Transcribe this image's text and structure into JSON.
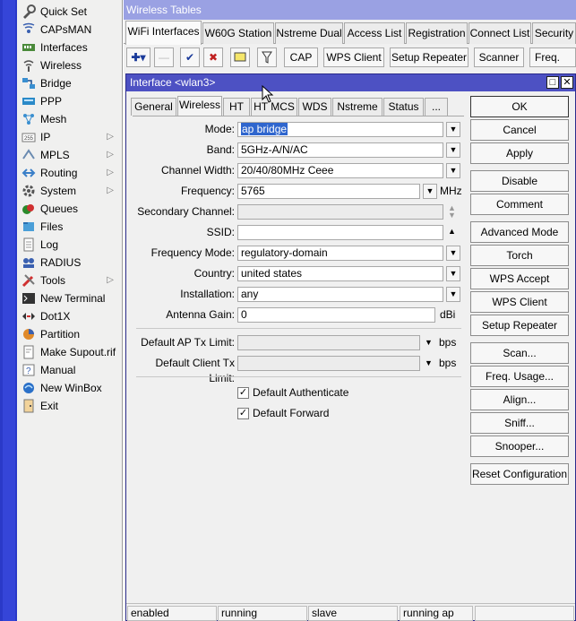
{
  "menu": {
    "items": [
      {
        "label": "Quick Set",
        "icon": "quick-set-icon",
        "arrow": ""
      },
      {
        "label": "CAPsMAN",
        "icon": "capsman-icon",
        "arrow": ""
      },
      {
        "label": "Interfaces",
        "icon": "interfaces-icon",
        "arrow": ""
      },
      {
        "label": "Wireless",
        "icon": "wireless-icon",
        "arrow": ""
      },
      {
        "label": "Bridge",
        "icon": "bridge-icon",
        "arrow": ""
      },
      {
        "label": "PPP",
        "icon": "ppp-icon",
        "arrow": ""
      },
      {
        "label": "Mesh",
        "icon": "mesh-icon",
        "arrow": ""
      },
      {
        "label": "IP",
        "icon": "ip-icon",
        "arrow": "▷"
      },
      {
        "label": "MPLS",
        "icon": "mpls-icon",
        "arrow": "▷"
      },
      {
        "label": "Routing",
        "icon": "routing-icon",
        "arrow": "▷"
      },
      {
        "label": "System",
        "icon": "system-icon",
        "arrow": "▷"
      },
      {
        "label": "Queues",
        "icon": "queues-icon",
        "arrow": ""
      },
      {
        "label": "Files",
        "icon": "files-icon",
        "arrow": ""
      },
      {
        "label": "Log",
        "icon": "log-icon",
        "arrow": ""
      },
      {
        "label": "RADIUS",
        "icon": "radius-icon",
        "arrow": ""
      },
      {
        "label": "Tools",
        "icon": "tools-icon",
        "arrow": "▷"
      },
      {
        "label": "New Terminal",
        "icon": "terminal-icon",
        "arrow": ""
      },
      {
        "label": "Dot1X",
        "icon": "dot1x-icon",
        "arrow": ""
      },
      {
        "label": "Partition",
        "icon": "partition-icon",
        "arrow": ""
      },
      {
        "label": "Make Supout.rif",
        "icon": "supout-icon",
        "arrow": ""
      },
      {
        "label": "Manual",
        "icon": "manual-icon",
        "arrow": ""
      },
      {
        "label": "New WinBox",
        "icon": "winbox-icon",
        "arrow": ""
      },
      {
        "label": "Exit",
        "icon": "exit-icon",
        "arrow": ""
      }
    ]
  },
  "window": {
    "title": "Wireless Tables",
    "tabs": [
      "WiFi Interfaces",
      "W60G Station",
      "Nstreme Dual",
      "Access List",
      "Registration",
      "Connect List",
      "Security"
    ],
    "active_tab": 0
  },
  "toolbar": {
    "add": "✚▾",
    "remove": "—",
    "enable": "✔",
    "disable": "✖",
    "comment": "",
    "filter": "",
    "buttons": [
      "CAP",
      "WPS Client",
      "Setup Repeater",
      "Scanner",
      "Freq. Usa"
    ]
  },
  "dialog": {
    "title": "Interface <wlan3>",
    "tabs": [
      "General",
      "Wireless",
      "HT",
      "HT MCS",
      "WDS",
      "Nstreme",
      "Status",
      "..."
    ],
    "active_tab": 1,
    "fields": {
      "mode": {
        "label": "Mode:",
        "value": "ap bridge"
      },
      "band": {
        "label": "Band:",
        "value": "5GHz-A/N/AC"
      },
      "channel_width": {
        "label": "Channel Width:",
        "value": "20/40/80MHz Ceee"
      },
      "frequency": {
        "label": "Frequency:",
        "value": "5765",
        "unit": "MHz"
      },
      "secondary_channel": {
        "label": "Secondary Channel:",
        "value": ""
      },
      "ssid": {
        "label": "SSID:",
        "value": ""
      },
      "frequency_mode": {
        "label": "Frequency Mode:",
        "value": "regulatory-domain"
      },
      "country": {
        "label": "Country:",
        "value": "united states"
      },
      "installation": {
        "label": "Installation:",
        "value": "any"
      },
      "antenna_gain": {
        "label": "Antenna Gain:",
        "value": "0",
        "unit": "dBi"
      },
      "default_ap_tx_limit": {
        "label": "Default AP Tx Limit:",
        "value": "",
        "unit": "bps"
      },
      "default_client_tx_limit": {
        "label": "Default Client Tx Limit:",
        "value": "",
        "unit": "bps"
      }
    },
    "checkboxes": {
      "default_authenticate": {
        "label": "Default Authenticate",
        "checked": true
      },
      "default_forward": {
        "label": "Default Forward",
        "checked": true
      }
    },
    "buttons": [
      "OK",
      "Cancel",
      "Apply",
      "Disable",
      "Comment",
      "Advanced Mode",
      "Torch",
      "WPS Accept",
      "WPS Client",
      "Setup Repeater",
      "Scan...",
      "Freq. Usage...",
      "Align...",
      "Sniff...",
      "Snooper...",
      "Reset Configuration"
    ],
    "status": [
      "enabled",
      "running",
      "slave",
      "running ap",
      ""
    ]
  },
  "colors": {
    "sidebar_strip": "#2a39c8",
    "window_titlebar": "#9aa1e3",
    "dialog_titlebar": "#4d51c3",
    "selection": "#2f66ce"
  }
}
